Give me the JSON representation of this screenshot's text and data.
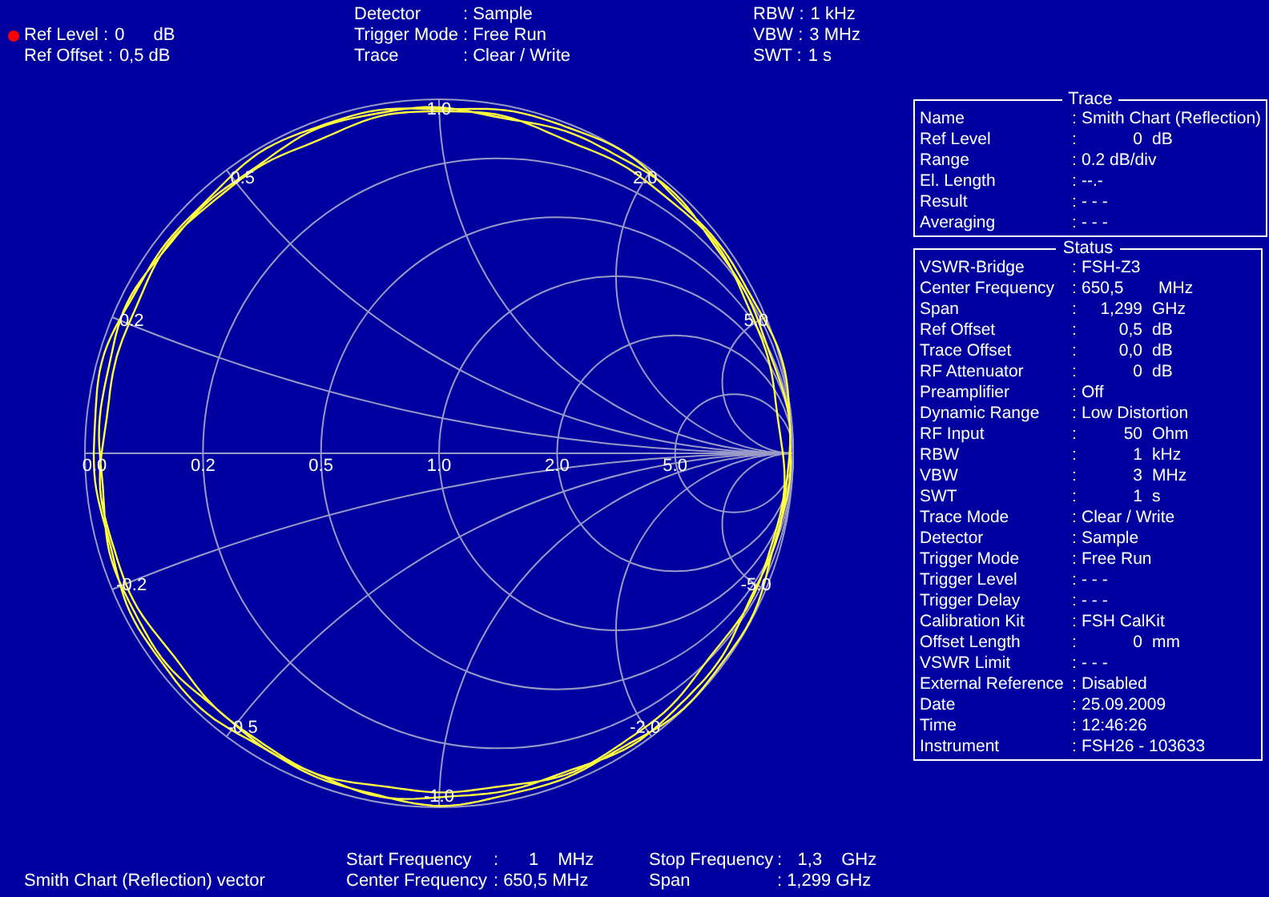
{
  "header": {
    "left": [
      {
        "label": "Ref Level :",
        "value": "0",
        "unit": "dB",
        "marker": true
      },
      {
        "label": "Ref Offset :",
        "value": "0,5 dB",
        "marker": false
      }
    ],
    "middle": [
      {
        "label": "Detector",
        "value": ": Sample"
      },
      {
        "label": "Trigger Mode",
        "value": ": Free Run"
      },
      {
        "label": "Trace",
        "value": ": Clear / Write"
      }
    ],
    "right": [
      {
        "label": "RBW :",
        "value": "1 kHz"
      },
      {
        "label": "VBW :",
        "value": "3 MHz"
      },
      {
        "label": "SWT :",
        "value": "1 s"
      }
    ]
  },
  "chart": {
    "reactance_labels": [
      "1.0",
      "2.0",
      "5.0",
      "-5.0",
      "-2.0",
      "-1.0",
      "-0.5",
      "-0.2",
      "0.2",
      "0.5"
    ],
    "resistance_labels": [
      "0.0",
      "0.2",
      "0.5",
      "1.0",
      "2.0",
      "5.0"
    ]
  },
  "panels": [
    {
      "title": "Trace",
      "rows": [
        {
          "label": "Name",
          "sep": ":",
          "value": "Smith Chart (Reflection)",
          "kind": "text"
        },
        {
          "label": "Ref Level",
          "sep": ":",
          "value": "0",
          "unit": "dB",
          "kind": "num"
        },
        {
          "label": "Range",
          "sep": ":",
          "value": "0.2 dB/div",
          "kind": "text"
        },
        {
          "label": "El. Length",
          "sep": ":",
          "value": "--.-",
          "kind": "text"
        },
        {
          "label": "Result",
          "sep": ":",
          "value": "- - -",
          "kind": "text"
        },
        {
          "label": "Averaging",
          "sep": ":",
          "value": "- - -",
          "kind": "text"
        }
      ]
    },
    {
      "title": "Status",
      "rows": [
        {
          "label": "VSWR-Bridge",
          "sep": ":",
          "value": "FSH-Z3",
          "kind": "text"
        },
        {
          "label": "Center Frequency",
          "sep": ":",
          "value": "650,5",
          "unit": "MHz",
          "kind": "left"
        },
        {
          "label": "Span",
          "sep": ":",
          "value": "1,299",
          "unit": "GHz",
          "kind": "num"
        },
        {
          "label": "Ref Offset",
          "sep": ":",
          "value": "0,5",
          "unit": "dB",
          "kind": "num"
        },
        {
          "label": "Trace Offset",
          "sep": ":",
          "value": "0,0",
          "unit": "dB",
          "kind": "num"
        },
        {
          "label": "RF Attenuator",
          "sep": ":",
          "value": "0",
          "unit": "dB",
          "kind": "num"
        },
        {
          "label": "Preamplifier",
          "sep": ":",
          "value": "Off",
          "kind": "text"
        },
        {
          "label": "Dynamic Range",
          "sep": ":",
          "value": "Low Distortion",
          "kind": "text"
        },
        {
          "label": "RF Input",
          "sep": ":",
          "value": "50",
          "unit": "Ohm",
          "kind": "num"
        },
        {
          "label": "RBW",
          "sep": ":",
          "value": "1",
          "unit": "kHz",
          "kind": "num"
        },
        {
          "label": "VBW",
          "sep": ":",
          "value": "3",
          "unit": "MHz",
          "kind": "num"
        },
        {
          "label": "SWT",
          "sep": ":",
          "value": "1",
          "unit": "s",
          "kind": "num"
        },
        {
          "label": "Trace Mode",
          "sep": ":",
          "value": "Clear / Write",
          "kind": "text"
        },
        {
          "label": "Detector",
          "sep": ":",
          "value": "Sample",
          "kind": "text"
        },
        {
          "label": "Trigger Mode",
          "sep": ":",
          "value": "Free Run",
          "kind": "text"
        },
        {
          "label": "Trigger Level",
          "sep": ":",
          "value": "- - -",
          "kind": "text"
        },
        {
          "label": "Trigger Delay",
          "sep": ":",
          "value": "- - -",
          "kind": "text"
        },
        {
          "label": "Calibration Kit",
          "sep": ":",
          "value": "FSH CalKit",
          "kind": "text"
        },
        {
          "label": "Offset Length",
          "sep": ":",
          "value": "0",
          "unit": "mm",
          "kind": "num"
        },
        {
          "label": "VSWR Limit",
          "sep": ":",
          "value": "- - -",
          "kind": "text"
        },
        {
          "label": "External Reference",
          "sep": ":",
          "value": "Disabled",
          "kind": "text"
        },
        {
          "label": "Date",
          "sep": ":",
          "value": "25.09.2009",
          "kind": "text"
        },
        {
          "label": "Time",
          "sep": ":",
          "value": "12:46:26",
          "kind": "text"
        },
        {
          "label": "Instrument",
          "sep": ":",
          "value": "FSH26 - 103633",
          "kind": "text"
        }
      ]
    }
  ],
  "footer": {
    "mode": "Smith Chart (Reflection) vector",
    "frequencies": [
      {
        "label": "Start Frequency",
        "sep": ":",
        "value": "1",
        "unit": "MHz"
      },
      {
        "label": "Center Frequency",
        "sep": ":",
        "value": "650,5 MHz"
      },
      {
        "label": "Stop Frequency",
        "sep": ":",
        "value": "1,3",
        "unit": "GHz"
      },
      {
        "label": "Span",
        "sep": ":",
        "value": "1,299 GHz"
      }
    ]
  }
}
